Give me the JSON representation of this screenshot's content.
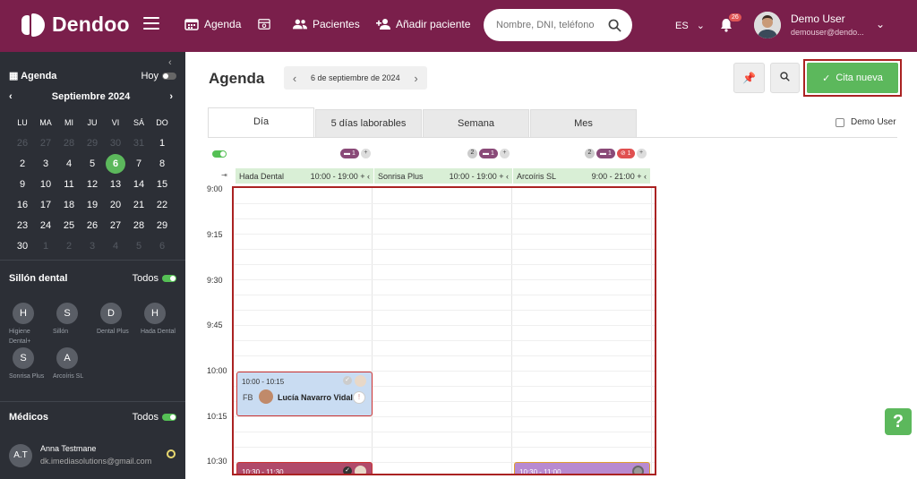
{
  "header": {
    "logo": "Dendoo",
    "nav": {
      "agenda": "Agenda",
      "pacientes": "Pacientes",
      "anadir": "Añadir paciente"
    },
    "search_placeholder": "Nombre, DNI, teléfono",
    "lang": "ES",
    "notif_count": "26",
    "user_name": "Demo User",
    "user_email": "demouser@dendo..."
  },
  "sidebar": {
    "agenda_label": "Agenda",
    "today_label": "Hoy",
    "month": "Septiembre 2024",
    "dow": [
      "LU",
      "MA",
      "MI",
      "JU",
      "VI",
      "SÁ",
      "DO"
    ],
    "weeks": [
      [
        "26",
        "27",
        "28",
        "29",
        "30",
        "31",
        "1"
      ],
      [
        "2",
        "3",
        "4",
        "5",
        "6",
        "7",
        "8"
      ],
      [
        "9",
        "10",
        "11",
        "12",
        "13",
        "14",
        "15"
      ],
      [
        "16",
        "17",
        "18",
        "19",
        "20",
        "21",
        "22"
      ],
      [
        "23",
        "24",
        "25",
        "26",
        "27",
        "28",
        "29"
      ],
      [
        "30",
        "1",
        "2",
        "3",
        "4",
        "5",
        "6"
      ]
    ],
    "selected_day": "6",
    "chairs_title": "Sillón dental",
    "chairs_all": "Todos",
    "chairs": [
      {
        "initial": "H",
        "label": "Higiene Dental+"
      },
      {
        "initial": "S",
        "label": "Sillón"
      },
      {
        "initial": "D",
        "label": "Dental Plus"
      },
      {
        "initial": "H",
        "label": "Hada Dental"
      },
      {
        "initial": "S",
        "label": "Sonrisa Plus"
      },
      {
        "initial": "A",
        "label": "Arcoíris SL"
      }
    ],
    "doctors_title": "Médicos",
    "doctors_all": "Todos",
    "doctor": {
      "initials": "A.T",
      "name": "Anna Testmane",
      "email": "dk.imediasolutions@gmail.com"
    }
  },
  "main": {
    "title": "Agenda",
    "date": "6 de septiembre de 2024",
    "new_button": "Cita nueva",
    "tabs": [
      "Día",
      "5 días laborables",
      "Semana",
      "Mes"
    ],
    "demo_checkbox": "Demo User",
    "columns": [
      {
        "name": "Hada Dental",
        "hours": "10:00 - 19:00"
      },
      {
        "name": "Sonrisa Plus",
        "hours": "10:00 - 19:00"
      },
      {
        "name": "Arcoíris SL",
        "hours": "9:00 - 21:00"
      }
    ],
    "chips": {
      "c1": "1",
      "c2": "2",
      "c2b": "1",
      "c3": "2",
      "c3b": "1",
      "c3c": "1"
    },
    "times": [
      "9:00",
      "9:15",
      "9:30",
      "9:45",
      "10:00",
      "10:15",
      "10:30"
    ],
    "appointments": [
      {
        "time": "10:00 - 10:15",
        "initials": "FB",
        "patient": "Lucía Navarro Vidal"
      },
      {
        "time": "10:30 - 11:30"
      },
      {
        "time": "10:30 - 11:00"
      }
    ]
  },
  "colors": {
    "brand": "#7a1f4b",
    "sidebar": "#2c2f36",
    "accent": "#5cb85c"
  }
}
